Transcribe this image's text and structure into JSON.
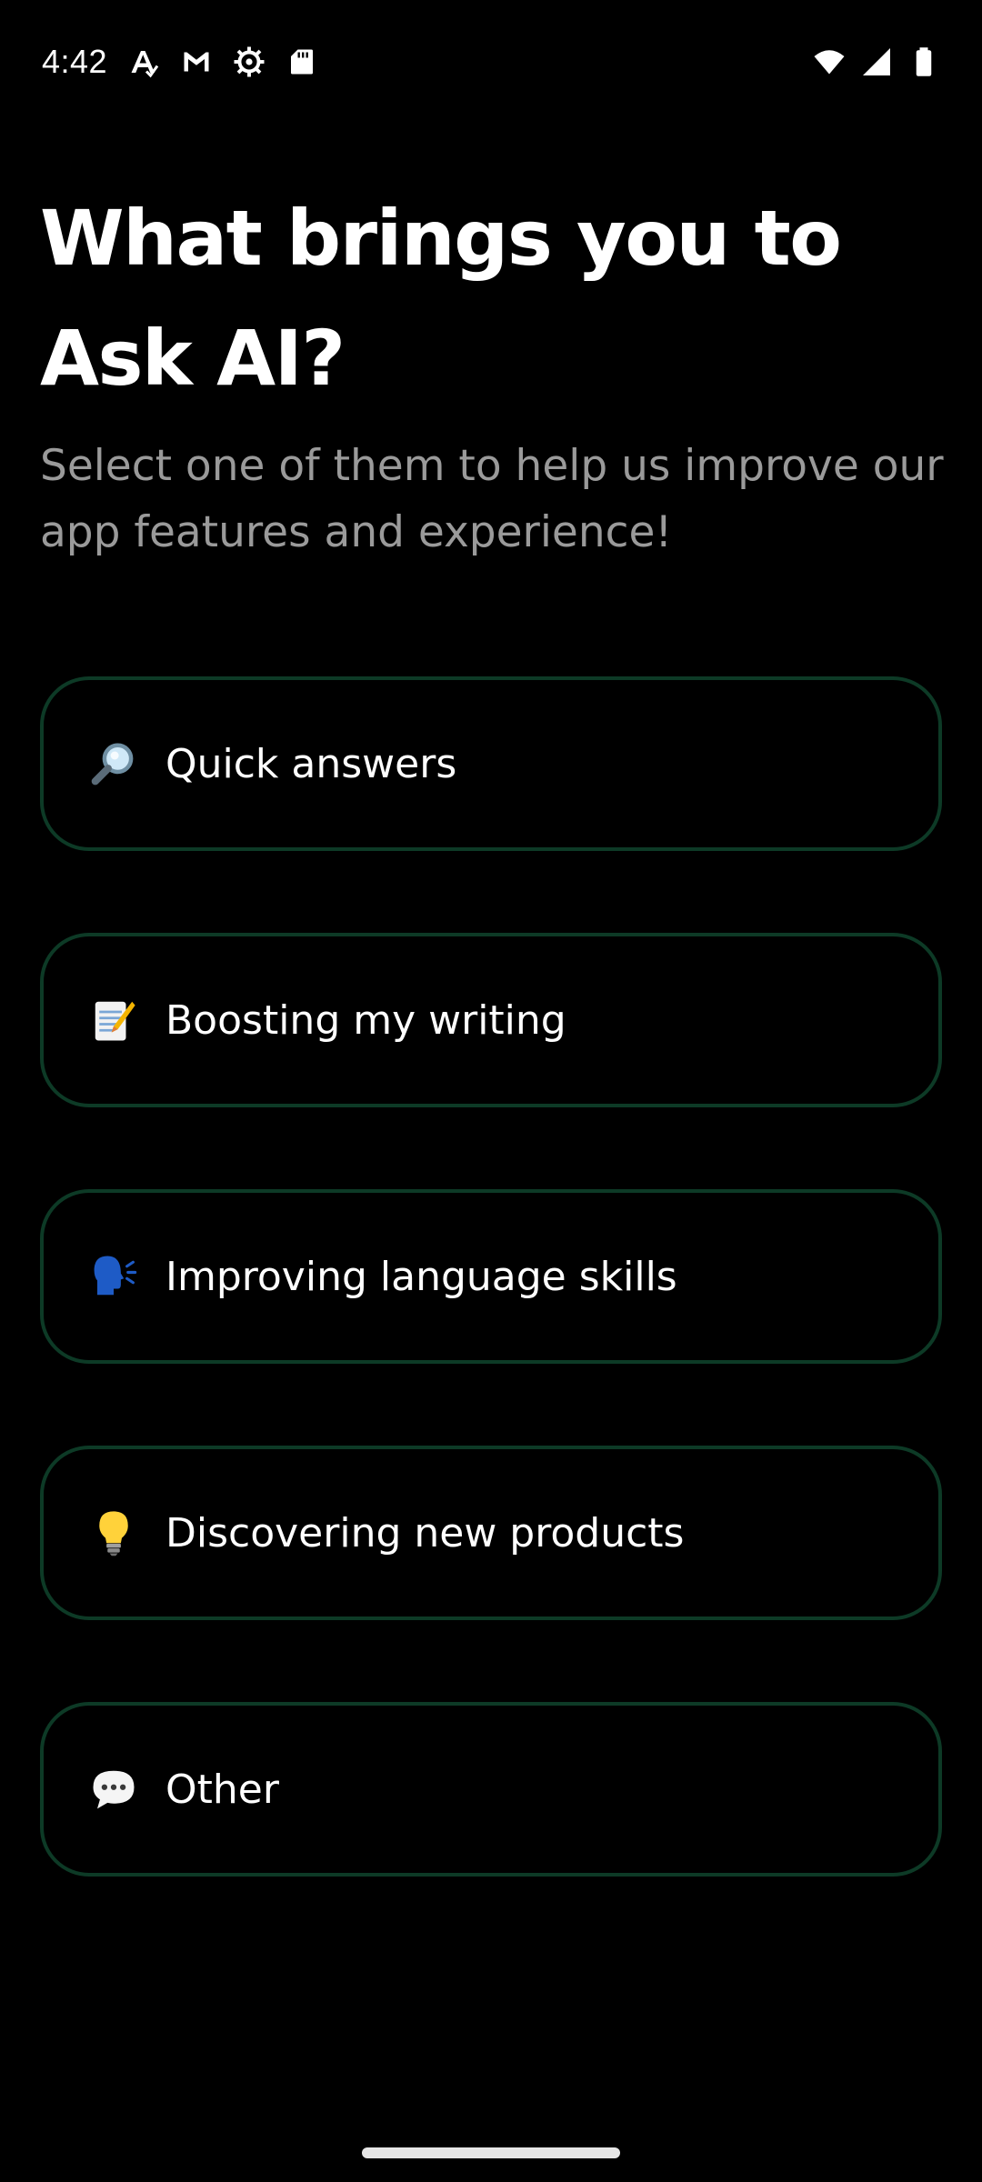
{
  "status_bar": {
    "time": "4:42",
    "left_icons": [
      "font-icon",
      "gmail-icon",
      "settings-gear-icon",
      "sd-card-icon"
    ],
    "right_icons": [
      "wifi-icon",
      "cellular-signal-icon",
      "battery-icon"
    ]
  },
  "header": {
    "title": "What brings you to Ask AI?",
    "subtitle": "Select one of them to help us improve our app features and experience!"
  },
  "options": [
    {
      "emoji": "magnifying-glass-icon",
      "label": "Quick answers"
    },
    {
      "emoji": "memo-icon",
      "label": "Boosting my writing"
    },
    {
      "emoji": "speaking-head-icon",
      "label": "Improving language skills"
    },
    {
      "emoji": "light-bulb-icon",
      "label": "Discovering new products"
    },
    {
      "emoji": "speech-bubble-icon",
      "label": "Other"
    }
  ],
  "colors": {
    "background": "#000000",
    "option_border": "#0d3a26",
    "subtitle": "#9a9a9a"
  }
}
